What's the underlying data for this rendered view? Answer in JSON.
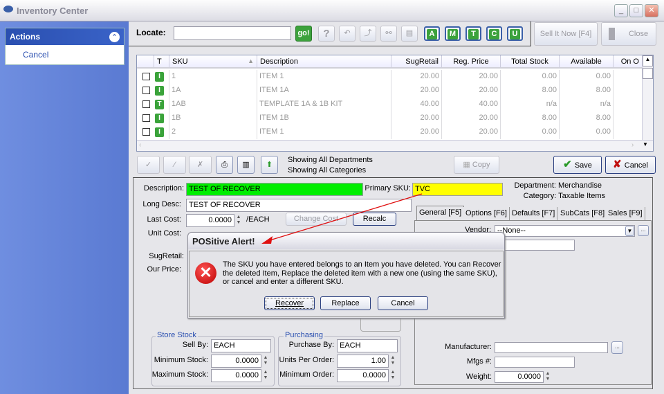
{
  "window": {
    "title": "Inventory Center",
    "icon": "app-logo-icon"
  },
  "sidebar": {
    "header": "Actions",
    "items": [
      {
        "label": "Cancel"
      }
    ]
  },
  "toolbar": {
    "locate_label": "Locate:",
    "locate_value": "",
    "go_label": "go!",
    "filter_buttons": [
      "A",
      "M",
      "T",
      "C",
      "U"
    ],
    "sell_it_now": "Sell It Now [F4]",
    "close": "Close"
  },
  "grid": {
    "columns": [
      "T",
      "SKU",
      "Description",
      "SugRetail",
      "Reg. Price",
      "Total Stock",
      "Available",
      "On O"
    ],
    "rows": [
      {
        "type": "I",
        "sku": "1",
        "description": "ITEM 1",
        "sugretail": "20.00",
        "reg_price": "20.00",
        "total_stock": "0.00",
        "available": "0.00"
      },
      {
        "type": "I",
        "sku": "1A",
        "description": "ITEM 1A",
        "sugretail": "20.00",
        "reg_price": "20.00",
        "total_stock": "8.00",
        "available": "8.00"
      },
      {
        "type": "T",
        "sku": "1AB",
        "description": "TEMPLATE 1A & 1B KIT",
        "sugretail": "40.00",
        "reg_price": "40.00",
        "total_stock": "n/a",
        "available": "n/a"
      },
      {
        "type": "I",
        "sku": "1B",
        "description": "ITEM 1B",
        "sugretail": "20.00",
        "reg_price": "20.00",
        "total_stock": "8.00",
        "available": "8.00"
      },
      {
        "type": "I",
        "sku": "2",
        "description": "ITEM 1",
        "sugretail": "20.00",
        "reg_price": "20.00",
        "total_stock": "0.00",
        "available": "0.00"
      }
    ]
  },
  "status": {
    "departments": "Showing All Departments",
    "categories": "Showing All Categories",
    "copy": "Copy",
    "save": "Save",
    "cancel": "Cancel"
  },
  "form": {
    "description_label": "Description:",
    "description": "TEST OF RECOVER",
    "primary_sku_label": "Primary SKU:",
    "primary_sku": "TVC",
    "department": "Department: Merchandise",
    "category": "Category: Taxable Items",
    "long_desc_label": "Long Desc:",
    "long_desc": "TEST OF RECOVER",
    "last_cost_label": "Last Cost:",
    "last_cost": "0.0000",
    "unit": "/EACH",
    "change_cost": "Change Cost",
    "recalc": "Recalc",
    "unit_cost_label": "Unit Cost:",
    "sugretail_label": "SugRetail:",
    "our_price_label": "Our Price:",
    "store_stock": {
      "title": "Store Stock",
      "sell_by_label": "Sell By:",
      "sell_by": "EACH",
      "min_label": "Minimum Stock:",
      "min": "0.0000",
      "max_label": "Maximum Stock:",
      "max": "0.0000"
    },
    "purchasing": {
      "title": "Purchasing",
      "purchase_by_label": "Purchase By:",
      "purchase_by": "EACH",
      "units_label": "Units Per Order:",
      "units": "1.00",
      "min_order_label": "Minimum Order:",
      "min_order": "0.0000"
    },
    "tabs": [
      "General [F5]",
      "Options [F6]",
      "Defaults [F7]",
      "SubCats [F8]",
      "Sales [F9]"
    ],
    "vendor_label": "Vendor:",
    "vendor": "--None--",
    "manufacturer_label": "Manufacturer:",
    "mfgs_label": "Mfgs #:",
    "weight_label": "Weight:",
    "weight": "0.0000"
  },
  "dialog": {
    "title": "POSitive Alert!",
    "message": "The SKU you have entered belongs to an Item you have deleted.  You can Recover the deleted Item, Replace the deleted item with a new one (using the same SKU), or cancel and enter a different SKU.",
    "recover": "Recover",
    "replace": "Replace",
    "cancel": "Cancel"
  },
  "colors": {
    "description_bg": "#00ee00",
    "sku_bg": "#ffff00",
    "arrow": "#e01010",
    "sidebar": "#6f8ee0"
  }
}
